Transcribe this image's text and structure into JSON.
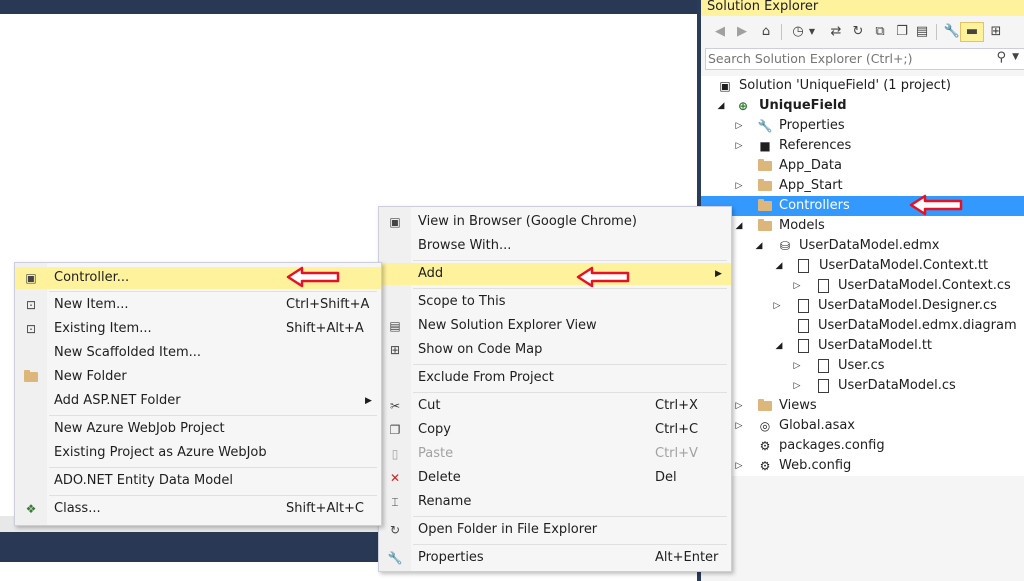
{
  "solution_explorer": {
    "title": "Solution Explorer",
    "search_placeholder": "Search Solution Explorer (Ctrl+;)",
    "toolbar_icons": [
      "back-icon",
      "forward-icon",
      "home-icon",
      "history-icon",
      "dropdown-icon",
      "sync-icon",
      "refresh-icon",
      "collapse-all-icon",
      "copy-icon",
      "show-all-files-icon",
      "properties-wrench-icon",
      "pin-icon",
      "class-view-icon"
    ],
    "tree": {
      "solution": "Solution 'UniqueField' (1 project)",
      "project": "UniqueField",
      "properties": "Properties",
      "references": "References",
      "app_data": "App_Data",
      "app_start": "App_Start",
      "controllers": "Controllers",
      "models": "Models",
      "edmx": "UserDataModel.edmx",
      "context_tt": "UserDataModel.Context.tt",
      "context_cs": "UserDataModel.Context.cs",
      "designer_cs": "UserDataModel.Designer.cs",
      "diagram": "UserDataModel.edmx.diagram",
      "model_tt": "UserDataModel.tt",
      "user_cs": "User.cs",
      "model_cs": "UserDataModel.cs",
      "views": "Views",
      "global": "Global.asax",
      "packages": "packages.config",
      "webconfig": "Web.config"
    }
  },
  "context_menu": {
    "items": [
      {
        "label": "View in Browser (Google Chrome)",
        "shortcut": ""
      },
      {
        "label": "Browse With...",
        "shortcut": ""
      },
      {
        "label": "Add",
        "shortcut": ""
      },
      {
        "label": "Scope to This",
        "shortcut": ""
      },
      {
        "label": "New Solution Explorer View",
        "shortcut": ""
      },
      {
        "label": "Show on Code Map",
        "shortcut": ""
      },
      {
        "label": "Exclude From Project",
        "shortcut": ""
      },
      {
        "label": "Cut",
        "shortcut": "Ctrl+X"
      },
      {
        "label": "Copy",
        "shortcut": "Ctrl+C"
      },
      {
        "label": "Paste",
        "shortcut": "Ctrl+V"
      },
      {
        "label": "Delete",
        "shortcut": "Del"
      },
      {
        "label": "Rename",
        "shortcut": ""
      },
      {
        "label": "Open Folder in File Explorer",
        "shortcut": ""
      },
      {
        "label": "Properties",
        "shortcut": "Alt+Enter"
      }
    ]
  },
  "add_submenu": {
    "items": [
      {
        "label": "Controller...",
        "shortcut": ""
      },
      {
        "label": "New Item...",
        "shortcut": "Ctrl+Shift+A"
      },
      {
        "label": "Existing Item...",
        "shortcut": "Shift+Alt+A"
      },
      {
        "label": "New Scaffolded Item...",
        "shortcut": ""
      },
      {
        "label": "New Folder",
        "shortcut": ""
      },
      {
        "label": "Add ASP.NET Folder",
        "shortcut": ""
      },
      {
        "label": "New Azure WebJob Project",
        "shortcut": ""
      },
      {
        "label": "Existing Project as Azure WebJob",
        "shortcut": ""
      },
      {
        "label": "ADO.NET Entity Data Model",
        "shortcut": ""
      },
      {
        "label": "Class...",
        "shortcut": "Shift+Alt+C"
      }
    ]
  },
  "colors": {
    "highlight": "#fff29d",
    "selection": "#3399ff",
    "annotation_arrow": "#e81123",
    "editor_frame": "#293955"
  }
}
